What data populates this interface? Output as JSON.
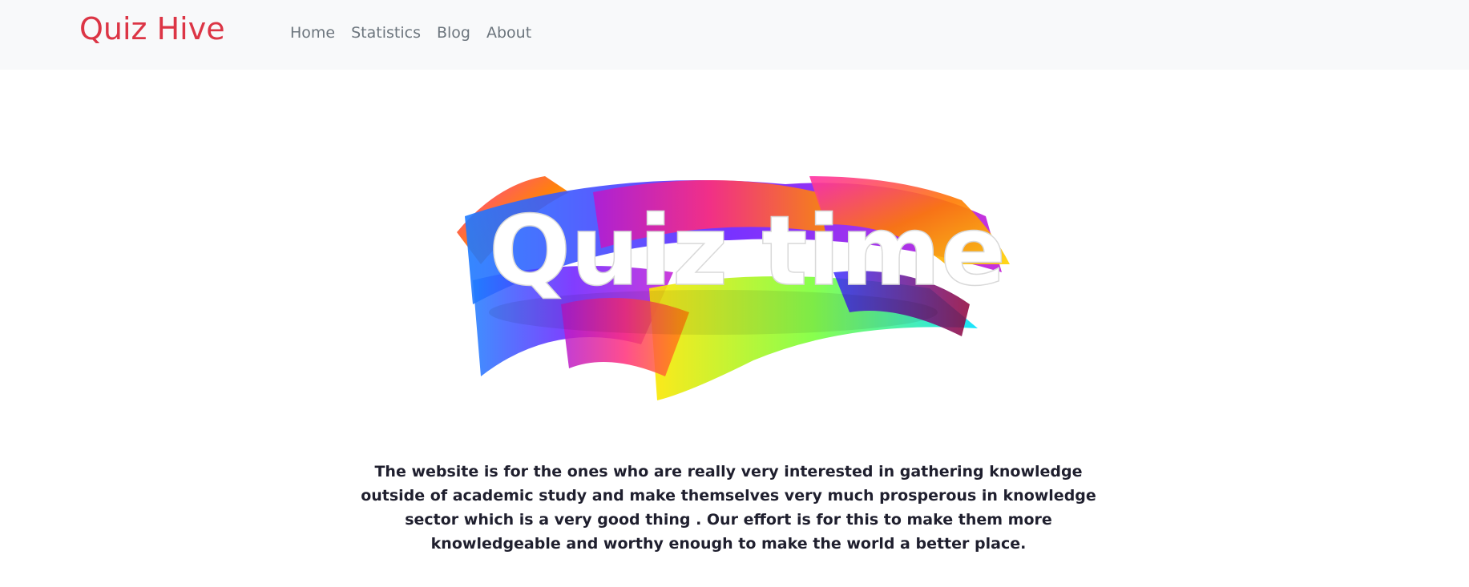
{
  "navbar": {
    "brand": "Quiz Hive",
    "links": [
      {
        "label": "Home"
      },
      {
        "label": "Statistics"
      },
      {
        "label": "Blog"
      },
      {
        "label": "About"
      }
    ]
  },
  "hero": {
    "banner_text": "Quiz time"
  },
  "main": {
    "description": "The website is for the ones who are really very interested in gathering knowledge outside of academic study and make themselves very much prosperous in knowledge sector which is a very good thing . Our effort is for this to make them more knowledgeable and worthy enough to make the world a better place."
  },
  "colors": {
    "brand": "#dc3545",
    "navbar_bg": "#f8f9fa",
    "nav_link": "#6c757d"
  }
}
